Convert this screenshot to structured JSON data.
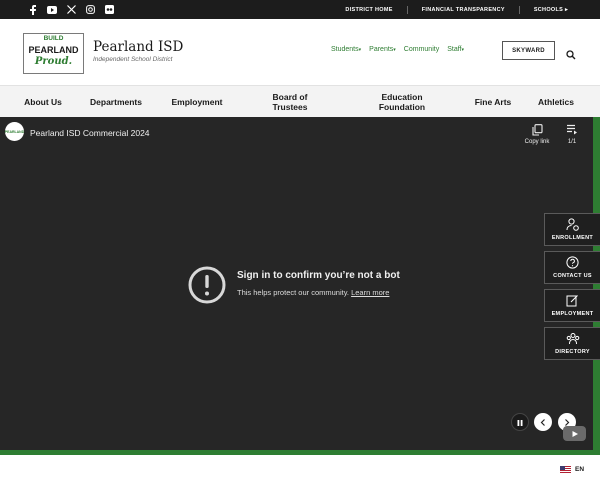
{
  "topbar": {
    "social": [
      "facebook-icon",
      "youtube-icon",
      "x-icon",
      "instagram-icon",
      "flickr-icon"
    ],
    "links": [
      "DISTRICT HOME",
      "FINANCIAL TRANSPARENCY",
      "SCHOOLS"
    ],
    "schools_caret": "▸"
  },
  "header": {
    "logo": {
      "line1": "BUILD",
      "line2": "PEARLAND",
      "line3": "Proud."
    },
    "title": "Pearland ISD",
    "subtitle": "Independent School District",
    "links": [
      "Students",
      "Parents",
      "Community",
      "Staff"
    ],
    "caret": "▾",
    "skyward": "SKYWARD"
  },
  "nav": [
    {
      "label": "About Us"
    },
    {
      "label": "Departments"
    },
    {
      "label": "Employment"
    },
    {
      "label": "Board of Trustees"
    },
    {
      "label": "Education Foundation"
    },
    {
      "label": "Fine Arts"
    },
    {
      "label": "Athletics"
    }
  ],
  "video": {
    "avatar_text": "PEARLAND",
    "title": "Pearland ISD Commercial 2024",
    "copy_link": "Copy link",
    "playlist_count": "1/1",
    "notice_title": "Sign in to confirm you’re not a bot",
    "notice_text": "This helps protect our community.",
    "learn_more": "Learn more"
  },
  "quick_links": [
    "ENROLLMENT",
    "CONTACT US",
    "EMPLOYMENT",
    "DIRECTORY"
  ],
  "footer": {
    "language": "EN"
  },
  "colors": {
    "green": "#2e7d32",
    "dark": "#1c1c1c",
    "video_bg": "#262626"
  }
}
